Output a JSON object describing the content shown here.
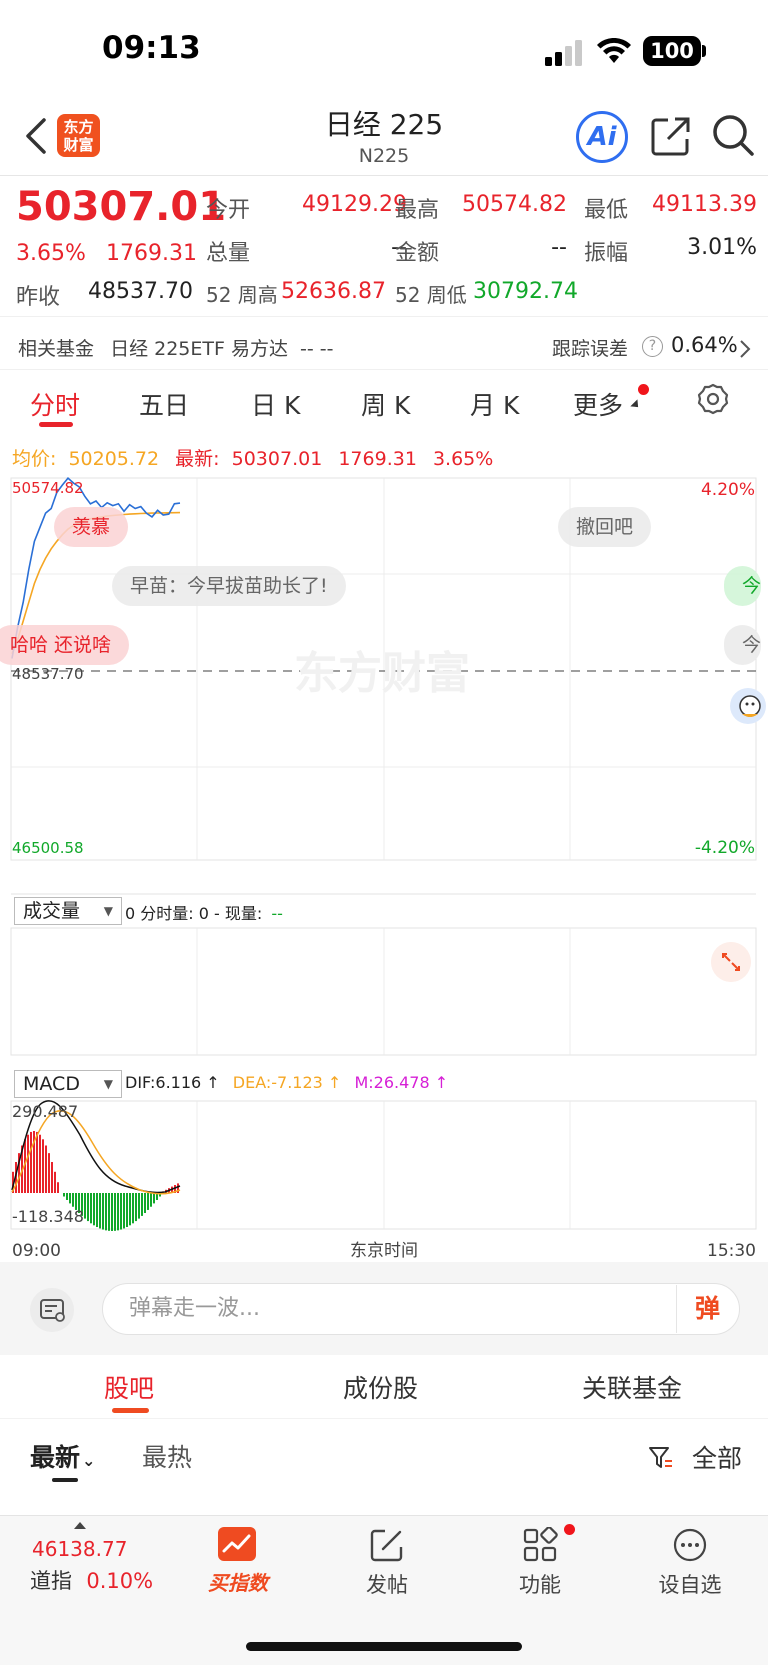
{
  "status_bar": {
    "time": "09:13",
    "battery": "100"
  },
  "header": {
    "logo_text": "东方财富",
    "title": "日经 225",
    "subtitle": "N225",
    "ai_label": "Ai"
  },
  "quote": {
    "price": "50307.01",
    "change_pct": "3.65%",
    "change": "1769.31",
    "prev_close_label": "昨收",
    "prev_close": "48537.70",
    "open_label": "今开",
    "open": "49129.29",
    "high_label": "最高",
    "high": "50574.82",
    "low_label": "最低",
    "low": "49113.39",
    "volume_label": "总量",
    "volume": "--",
    "amount_label": "金额",
    "amount": "--",
    "amplitude_label": "振幅",
    "amplitude": "3.01%",
    "wk52_high_label": "52 周高",
    "wk52_high": "52636.87",
    "wk52_low_label": "52 周低",
    "wk52_low": "30792.74"
  },
  "fund": {
    "label": "相关基金",
    "name": "日经 225ETF 易方达",
    "value": "-- --",
    "tracking_label": "跟踪误差",
    "tracking_value": "0.64%"
  },
  "tabs": [
    "分时",
    "五日",
    "日 K",
    "周 K",
    "月 K",
    "更多"
  ],
  "chart_info": {
    "avg_label": "均价:",
    "avg_value": "50205.72",
    "latest_label": "最新:",
    "latest_value": "50307.01",
    "latest_change": "1769.31",
    "latest_pct": "3.65%"
  },
  "chart_data": {
    "type": "line",
    "title": "",
    "x_start": "09:00",
    "x_end": "15:30",
    "x_center_label": "东京时间",
    "y_top": "50574.82",
    "y_ref": "48537.70",
    "y_bottom": "46500.58",
    "y_top_pct": "4.20%",
    "y_bottom_pct": "-4.20%",
    "ylim": [
      46500.58,
      50574.82
    ],
    "price_series": [
      48650,
      48980,
      49250,
      49600,
      49900,
      50050,
      50200,
      50250,
      50420,
      50500,
      50574,
      50520,
      50480,
      50380,
      50300,
      50330,
      50260,
      50310,
      50280,
      50300,
      50220,
      50290,
      50250,
      50270,
      50200,
      50160,
      50230,
      50180,
      50190,
      50300,
      50307
    ],
    "avg_series": [
      48700,
      48850,
      49050,
      49250,
      49450,
      49600,
      49720,
      49820,
      49900,
      49970,
      50030,
      50070,
      50100,
      50120,
      50140,
      50150,
      50160,
      50170,
      50175,
      50180,
      50185,
      50190,
      50193,
      50196,
      50198,
      50200,
      50202,
      50203,
      50204,
      50205,
      50205.72
    ],
    "macd": {
      "dif": "6.116",
      "dea": "-7.123",
      "m": "26.478",
      "y_top": "290.487",
      "y_bottom": "-118.348"
    }
  },
  "danmaku": [
    "羡慕",
    "早苗：今早拔苗助长了!",
    "哈哈  还说啥",
    "撤回吧",
    "今",
    "今"
  ],
  "watermark": "东方财富",
  "volume_panel": {
    "selector": "成交量",
    "info_prefix": "0 分时量: 0 - 现量:",
    "info_value": "--"
  },
  "macd_panel": {
    "selector": "MACD",
    "dif_label": "DIF:6.116 ↑",
    "dea_label": "DEA:-7.123 ↑",
    "m_label": "M:26.478 ↑"
  },
  "comment": {
    "placeholder": "弹幕走一波...",
    "toggle": "弹"
  },
  "community_tabs": [
    "股吧",
    "成份股",
    "关联基金"
  ],
  "sort": {
    "latest": "最新",
    "hot": "最热",
    "filter": "全部"
  },
  "bottom_nav": {
    "index_value": "46138.77",
    "index_name": "道指",
    "index_pct": "0.10%",
    "buy_index": "买指数",
    "post": "发帖",
    "function": "功能",
    "watchlist": "设自选"
  },
  "colors": {
    "up": "#e8232b",
    "down": "#11a82a",
    "price_line": "#2a6fd6",
    "avg_line": "#f5a623",
    "accent": "#ef4b21"
  }
}
